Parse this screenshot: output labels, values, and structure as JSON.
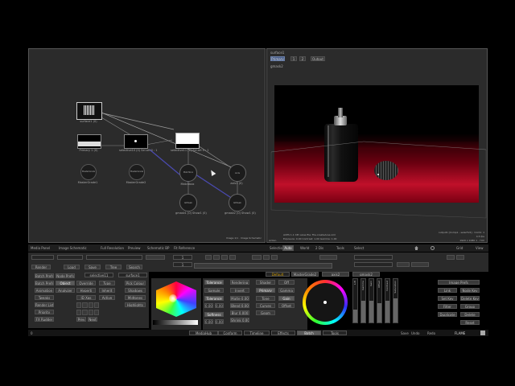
{
  "schematic": {
    "status": "Image 1/1 · Image Schematic",
    "nodes": [
      {
        "id": "surface1",
        "label": "surface1 (0)"
      },
      {
        "id": "primary",
        "label": "Primary 1 (0)"
      },
      {
        "id": "selective10",
        "label": "selective10 (0)  Sel.aH\n0 : 1"
      },
      {
        "id": "selective11",
        "label": "selective11 (1)  Sel.aH\n0 : 1"
      },
      {
        "id": "mastergrade1",
        "label": "MasterGrade1"
      },
      {
        "id": "mastergrade2",
        "label": "MasterGrade2"
      },
      {
        "id": "matchbox",
        "label": "Matchbox"
      },
      {
        "id": "gmask1",
        "label": "gmask1 (0)\nShow1 (0)"
      },
      {
        "id": "axis",
        "label": "Axis"
      },
      {
        "id": "gmask2",
        "label": "gmask2 (0)\nShow1 (0)"
      },
      {
        "id": "axis_lbl",
        "label": "axis1 (0)"
      }
    ],
    "node_glyphs": {
      "mastergrade": "MasterGrade",
      "matchbox": "Matchbox",
      "gmask": "GMask",
      "axis": "Axis"
    }
  },
  "viewer": {
    "top_title": "surface1",
    "buttons": [
      "Primary",
      "1",
      "2",
      "Output"
    ],
    "subtitle": "gmask2",
    "bottom_left_label": "Action",
    "bottom_right": "Result",
    "info_lines": [
      "ACES 1.1 CM value file: File.createAces.xml",
      "Exposure: 0.00    Contrast: 1.00    Gamma: 1.00"
    ],
    "right_lines": [
      "output1 [Comp1 - selectV4] · Comb: 1",
      "4.5 fps",
      "1920 x 1080 1 · YUV"
    ]
  },
  "toolbar": {
    "items": [
      "Media Panel",
      "Image Schematic",
      "Full Resolution",
      "Preview",
      "Schematic BP",
      "Fit Reference",
      "Selection",
      "Auto",
      "World",
      "2 Dis",
      "Tools",
      "Select",
      "Grid",
      "View"
    ],
    "frame": "1",
    "end_frame": "1"
  },
  "left_column": {
    "rows": [
      [
        "Render",
        "Load",
        "Save",
        "Tree",
        "Search"
      ],
      [
        "Batch Prefs",
        "Node Prefs",
        "Object",
        "Override",
        "Type",
        "Pick Colour"
      ],
      [
        "Animation",
        "Analyzer",
        "Hyperti",
        "Inherit",
        "Shadows"
      ],
      [
        "Tweaks",
        "",
        "ID Xgs",
        "Active",
        "Midtones"
      ],
      [
        "Render List",
        "",
        "",
        "",
        "Highlights"
      ],
      [
        "Priority"
      ],
      [
        "FX Rudder"
      ]
    ],
    "extra": [
      "Prev",
      "Next"
    ],
    "node_name": "selective11",
    "node_name2": "surface1"
  },
  "color_panel": {
    "tools": [
      "Tolerance",
      "Sample",
      "Tolerance",
      "Softness",
      "Softness"
    ],
    "values": [
      "0.00",
      "0.00",
      "0.00",
      "0.00"
    ],
    "right_tools": [
      "Rendering",
      "Invert",
      "Matte 0.00",
      "Blend 0.00",
      "Blur 0.000",
      "Shrink 0.00"
    ],
    "mode_items": [
      "Shader",
      "Primary",
      "Tone",
      "Curves",
      "Geom",
      "Conform"
    ],
    "mode_values": [
      "Off",
      "Gamma",
      "Gain",
      "Offset",
      "Hue"
    ]
  },
  "grading": {
    "tabs": [
      "Default",
      "MasterGrade2",
      "axis2",
      "gmask2"
    ],
    "wheel_active": "Master",
    "sliders": [
      "Lift",
      "Gamma",
      "Gain",
      "Offset",
      "Contrast",
      "Saturation"
    ],
    "slider_fill": [
      0.3,
      0.5,
      0.5,
      0.45,
      0.5,
      0.55
    ],
    "right_buttons": [
      "Image Prefs",
      "Link",
      "Node Key",
      "Set Key",
      "Delete Key",
      "Filter",
      "Group",
      "Duplicate",
      "Delete",
      "Reset"
    ]
  },
  "bottom_tabs": [
    "MediaHub",
    "Conform",
    "Timeline",
    "Effects",
    "Batch",
    "Tools"
  ],
  "active_tab": "Batch",
  "bottom_right": [
    "Save",
    "Undo",
    "Redo"
  ],
  "brand": "FLAME",
  "frame_counter": "0"
}
